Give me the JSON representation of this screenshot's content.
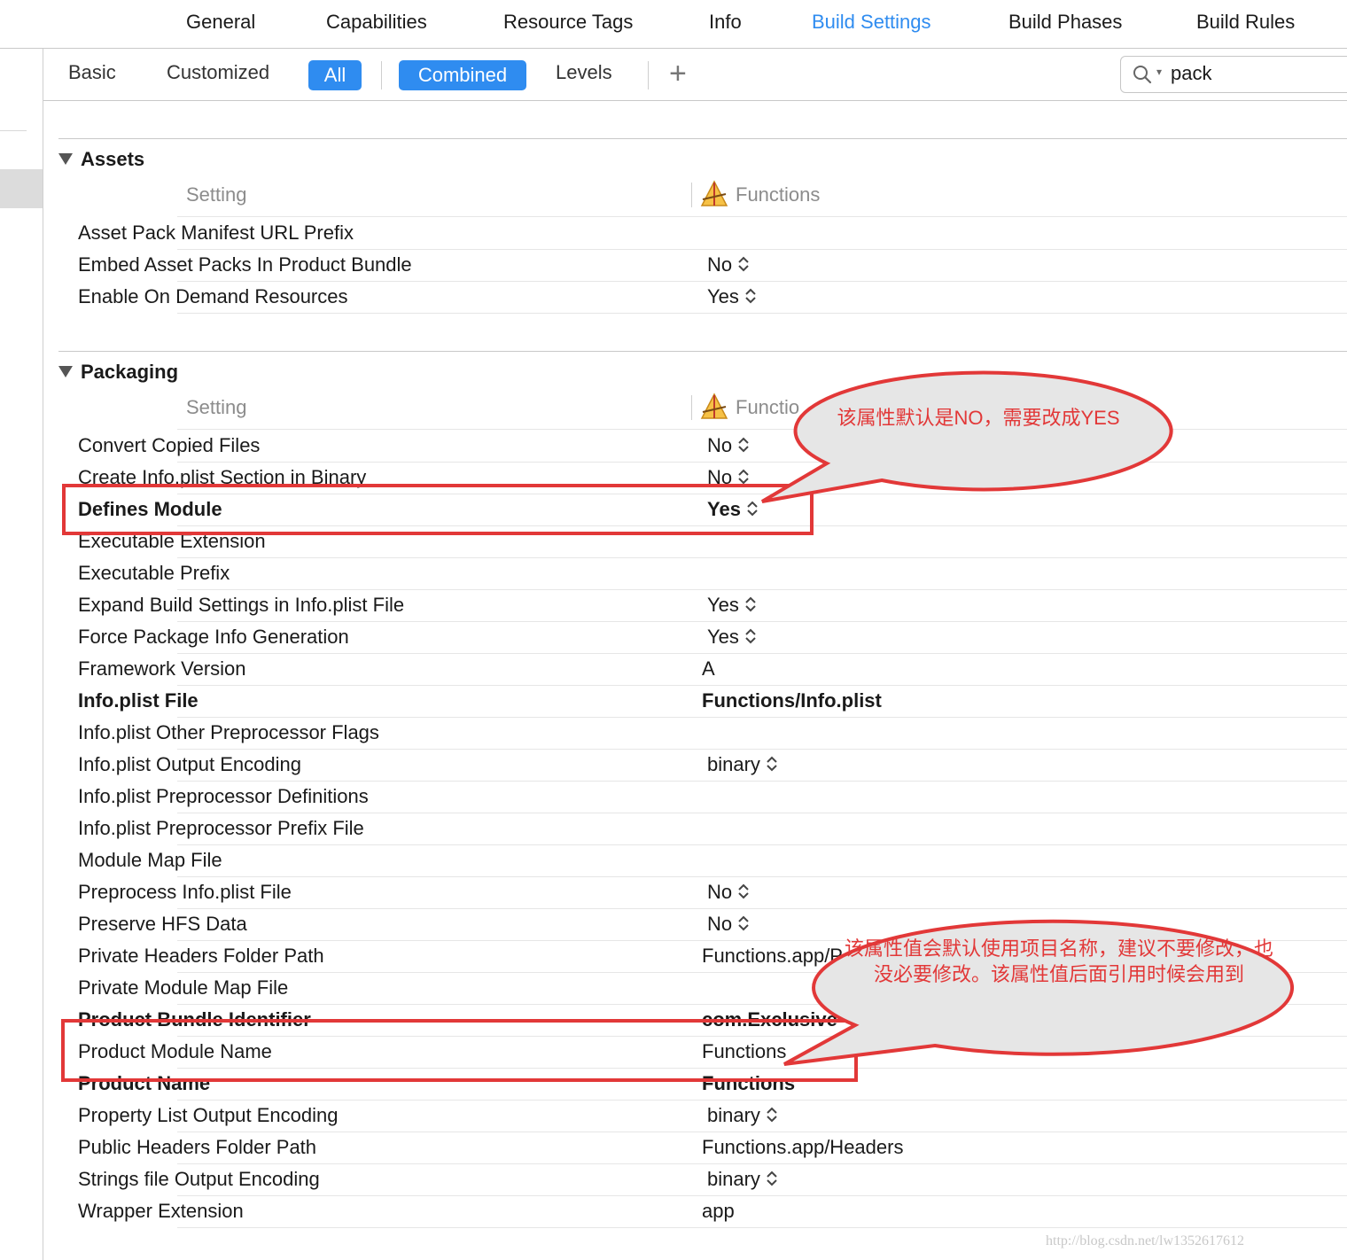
{
  "top_tabs": {
    "general": "General",
    "capabilities": "Capabilities",
    "resource_tags": "Resource Tags",
    "info": "Info",
    "build_settings": "Build Settings",
    "build_phases": "Build Phases",
    "build_rules": "Build Rules",
    "active": "Build Settings"
  },
  "filters": {
    "basic": "Basic",
    "customized": "Customized",
    "all": "All",
    "combined": "Combined",
    "levels": "Levels",
    "add_icon": "plus-icon"
  },
  "search": {
    "value": "pack",
    "icon": "search-icon"
  },
  "colors": {
    "accent": "#2f8cf0",
    "annotation": "#e23838",
    "callout_fill": "#e6e6e6"
  },
  "assets": {
    "title": "Assets",
    "col_setting": "Setting",
    "col_target": "Functions",
    "rows": [
      {
        "name": "Asset Pack Manifest URL Prefix",
        "value": ""
      },
      {
        "name": "Embed Asset Packs In Product Bundle",
        "value": "No"
      },
      {
        "name": "Enable On Demand Resources",
        "value": "Yes"
      }
    ]
  },
  "packaging": {
    "title": "Packaging",
    "col_setting": "Setting",
    "col_target": "Functio",
    "rows": [
      {
        "name": "Convert Copied Files",
        "value": "No"
      },
      {
        "name": "Create Info.plist Section in Binary",
        "value": "No"
      },
      {
        "name": "Defines Module",
        "value": "Yes"
      },
      {
        "name": "Executable Extension",
        "value": ""
      },
      {
        "name": "Executable Prefix",
        "value": ""
      },
      {
        "name": "Expand Build Settings in Info.plist File",
        "value": "Yes"
      },
      {
        "name": "Force Package Info Generation",
        "value": "Yes"
      },
      {
        "name": "Framework Version",
        "value": "A"
      },
      {
        "name": "Info.plist File",
        "value": "Functions/Info.plist"
      },
      {
        "name": "Info.plist Other Preprocessor Flags",
        "value": ""
      },
      {
        "name": "Info.plist Output Encoding",
        "value": "binary"
      },
      {
        "name": "Info.plist Preprocessor Definitions",
        "value": ""
      },
      {
        "name": "Info.plist Preprocessor Prefix File",
        "value": ""
      },
      {
        "name": "Module Map File",
        "value": ""
      },
      {
        "name": "Preprocess Info.plist File",
        "value": "No"
      },
      {
        "name": "Preserve HFS Data",
        "value": "No"
      },
      {
        "name": "Private Headers Folder Path",
        "value": "Functions.app/P"
      },
      {
        "name": "Private Module Map File",
        "value": ""
      },
      {
        "name": "Product Bundle Identifier",
        "value": "com.Exclusive"
      },
      {
        "name": "Product Module Name",
        "value": "Functions"
      },
      {
        "name": "Product Name",
        "value": "Functions"
      },
      {
        "name": "Property List Output Encoding",
        "value": "binary"
      },
      {
        "name": "Public Headers Folder Path",
        "value": "Functions.app/Headers"
      },
      {
        "name": "Strings file Output Encoding",
        "value": "binary"
      },
      {
        "name": "Wrapper Extension",
        "value": "app"
      }
    ]
  },
  "annotations": {
    "callout_1": "该属性默认是NO，需要改成YES",
    "callout_2": "该属性值会默认使用项目名称，建议不要修改，也没必要修改。该属性值后面引用时候会用到"
  },
  "watermark": "http://blog.csdn.net/lw1352617612"
}
